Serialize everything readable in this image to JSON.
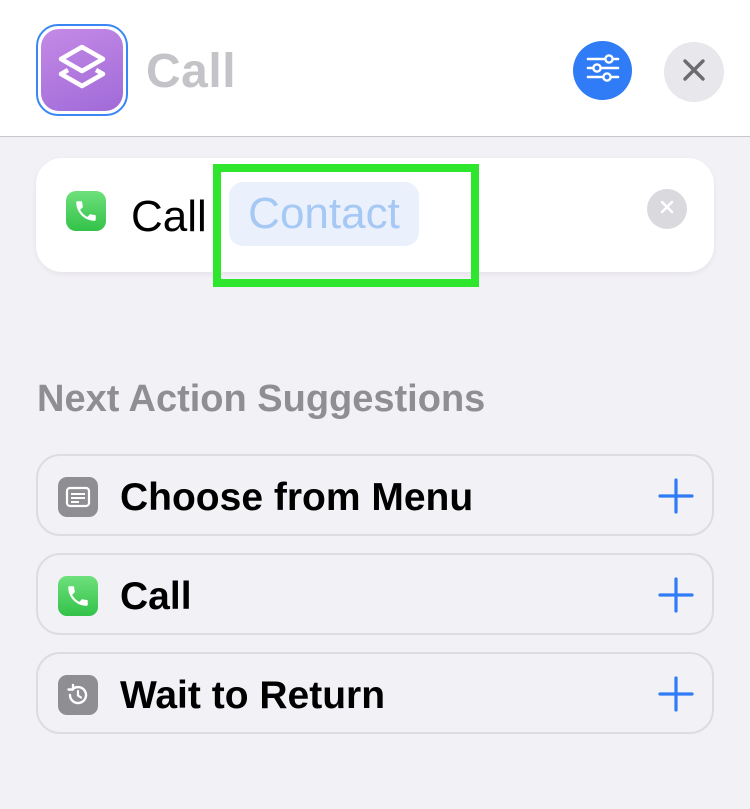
{
  "header": {
    "title": "Call",
    "app_icon": "shortcuts-icon",
    "settings_icon": "sliders-icon",
    "close_icon": "close-icon"
  },
  "action": {
    "icon": "phone-icon",
    "verb": "Call",
    "parameter": "Contact",
    "remove_icon": "remove-icon"
  },
  "suggestions": {
    "heading": "Next Action Suggestions",
    "items": [
      {
        "label": "Choose from Menu",
        "icon": "menu-icon",
        "add_icon": "plus-icon"
      },
      {
        "label": "Call",
        "icon": "phone-icon",
        "add_icon": "plus-icon"
      },
      {
        "label": "Wait to Return",
        "icon": "clock-return-icon",
        "add_icon": "plus-icon"
      }
    ]
  },
  "colors": {
    "accent": "#2f7cf6",
    "highlight": "#2ee62e",
    "app_purple": "#a06ad8",
    "phone_green": "#33c24a",
    "token_text": "#a6c8f4"
  }
}
